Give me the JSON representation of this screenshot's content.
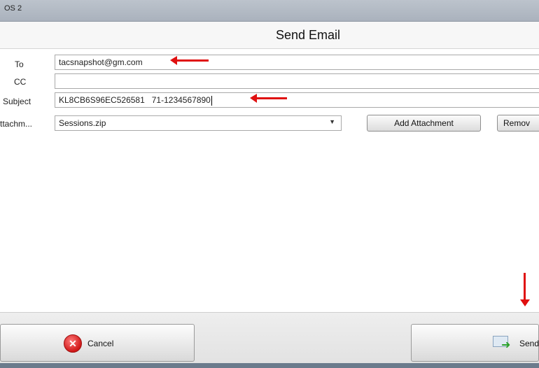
{
  "window": {
    "app_title": "OS 2"
  },
  "dialog": {
    "title": "Send Email"
  },
  "form": {
    "to_label": "To",
    "to_value": "tacsnapshot@gm.com",
    "cc_label": "CC",
    "cc_value": "",
    "subject_label": "Subject",
    "subject_value": "KL8CB6S96EC526581   71-1234567890",
    "attachment_label": "ttachm...",
    "attachment_selected": "Sessions.zip",
    "add_attachment_label": "Add Attachment",
    "remove_label": "Remov"
  },
  "footer": {
    "cancel_label": "Cancel",
    "send_label": "Send"
  },
  "colors": {
    "annotation_arrow": "#e01010"
  }
}
